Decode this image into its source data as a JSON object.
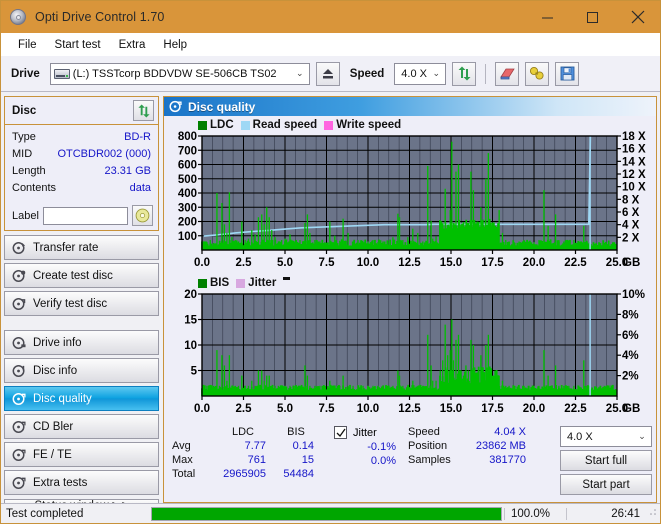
{
  "window": {
    "title": "Opti Drive Control 1.70",
    "title_icon": "disc-icon",
    "minimize": "–",
    "maximize": "□",
    "close": "✕",
    "accent_titlebar": "#d9953a"
  },
  "menubar": {
    "items": [
      {
        "label": "File"
      },
      {
        "label": "Start test"
      },
      {
        "label": "Extra"
      },
      {
        "label": "Help"
      }
    ]
  },
  "toolbar": {
    "drive_label": "Drive",
    "drive_value": "(L:)   TSSTcorp BDDVDW SE-506CB TS02",
    "eject_icon": "eject-icon",
    "speed_label": "Speed",
    "speed_value": "4.0 X",
    "refresh_icon": "refresh-icon",
    "erase_icon": "eraser-icon",
    "plug_icon": "plug-icon",
    "save_icon": "save-floppy-icon",
    "caret": "⌄"
  },
  "sidebar": {
    "disc_panel": {
      "title": "Disc",
      "refresh_icon": "refresh-icon",
      "rows": [
        {
          "key": "Type",
          "value": "BD-R"
        },
        {
          "key": "MID",
          "value": "OTCBDR002 (000)"
        },
        {
          "key": "Length",
          "value": "23.31 GB"
        },
        {
          "key": "Contents",
          "value": "data"
        }
      ],
      "label_key": "Label",
      "label_value": "",
      "label_placeholder": "",
      "label_button_icon": "disc-icon"
    },
    "items": [
      {
        "label": "Transfer rate",
        "icon": "disc-arrow-icon",
        "active": false
      },
      {
        "label": "Create test disc",
        "icon": "disc-write-icon",
        "active": false
      },
      {
        "label": "Verify test disc",
        "icon": "disc-check-icon",
        "active": false
      },
      {
        "label": "Drive info",
        "icon": "drive-info-icon",
        "active": false
      },
      {
        "label": "Disc info",
        "icon": "disc-info-icon",
        "active": false
      },
      {
        "label": "Disc quality",
        "icon": "disc-quality-icon",
        "active": true
      },
      {
        "label": "CD Bler",
        "icon": "disc-bler-icon",
        "active": false
      },
      {
        "label": "FE / TE",
        "icon": "disc-fete-icon",
        "active": false
      },
      {
        "label": "Extra tests",
        "icon": "disc-extra-icon",
        "active": false
      }
    ],
    "status_window_button": "Status window > >"
  },
  "main": {
    "header_title": "Disc quality",
    "header_icon": "disc-quality-icon"
  },
  "chart_data": [
    {
      "type": "line",
      "name": "ldc-chart",
      "title": "",
      "xlabel": "GB",
      "ylabel": "",
      "legend": [
        {
          "label": "LDC",
          "color": "#00a000"
        },
        {
          "label": "Read speed",
          "color": "#9fd8f5"
        },
        {
          "label": "Write speed",
          "color": "#ff66e0"
        }
      ],
      "legend_position": "top-left",
      "grid": true,
      "plot_bg": "#6b7489",
      "x": [
        0.0,
        2.5,
        5.0,
        7.5,
        10.0,
        12.5,
        15.0,
        17.5,
        20.0,
        22.5,
        25.0
      ],
      "xtick_labels": [
        "0.0",
        "2.5",
        "5.0",
        "7.5",
        "10.0",
        "12.5",
        "15.0",
        "17.5",
        "20.0",
        "22.5",
        "25.0"
      ],
      "xlim": [
        0.0,
        25.0
      ],
      "ylim": [
        0,
        800
      ],
      "ytick_labels": [
        "100",
        "200",
        "300",
        "400",
        "500",
        "600",
        "700",
        "800"
      ],
      "ytick_values": [
        100,
        200,
        300,
        400,
        500,
        600,
        700,
        800
      ],
      "y2lim": [
        0,
        18
      ],
      "y2tick_labels": [
        "2 X",
        "4 X",
        "6 X",
        "8 X",
        "10 X",
        "12 X",
        "14 X",
        "16 X",
        "18 X"
      ],
      "y2tick_values": [
        2,
        4,
        6,
        8,
        10,
        12,
        14,
        16,
        18
      ],
      "series": [
        {
          "name": "Read speed",
          "color": "#9fd8f5",
          "axis": "right",
          "x": [
            0.1,
            1.0,
            2.0,
            3.0,
            4.0,
            5.0,
            6.0,
            7.0,
            8.0,
            9.0,
            10.0,
            11.0,
            11.5,
            13.5,
            14.0,
            23.3,
            23.4
          ],
          "values": [
            2.2,
            2.4,
            2.7,
            2.9,
            3.1,
            3.3,
            3.5,
            3.6,
            3.7,
            3.8,
            3.9,
            4.0,
            4.0,
            4.0,
            4.05,
            4.05,
            18.0
          ]
        },
        {
          "name": "LDC",
          "color": "#00c000",
          "axis": "left",
          "note": "error spikes sampled across the disc",
          "x": [
            0.1,
            0.3,
            0.5,
            0.7,
            0.9,
            1.05,
            1.2,
            1.35,
            1.5,
            1.65,
            1.8,
            2.0,
            2.2,
            2.4,
            2.6,
            2.8,
            3.0,
            3.2,
            3.4,
            3.6,
            3.75,
            3.9,
            4.05,
            4.2,
            4.4,
            4.6,
            4.8,
            5.0,
            5.3,
            5.6,
            5.9,
            6.2,
            6.35,
            6.5,
            6.8,
            7.1,
            7.4,
            7.7,
            8.0,
            8.3,
            8.5,
            8.8,
            9.1,
            9.4,
            9.7,
            10.0,
            10.3,
            10.6,
            10.9,
            11.2,
            11.5,
            11.8,
            11.9,
            12.1,
            12.4,
            12.7,
            13.0,
            13.3,
            13.6,
            13.8,
            13.9,
            14.1,
            14.35,
            14.5,
            14.65,
            14.8,
            14.95,
            15.05,
            15.15,
            15.3,
            15.45,
            15.6,
            15.75,
            15.9,
            16.05,
            16.2,
            16.35,
            16.5,
            16.65,
            16.8,
            16.95,
            17.1,
            17.25,
            17.4,
            17.55,
            17.7,
            17.9,
            18.1,
            18.3,
            18.5,
            18.8,
            19.1,
            19.4,
            19.7,
            20.0,
            20.3,
            20.6,
            20.85,
            21.0,
            21.3,
            21.5,
            21.8,
            22.1,
            22.4,
            22.7,
            23.0,
            23.2,
            23.35
          ],
          "values": [
            60,
            55,
            70,
            50,
            400,
            65,
            330,
            180,
            120,
            405,
            90,
            70,
            60,
            200,
            70,
            80,
            140,
            110,
            230,
            250,
            180,
            300,
            230,
            140,
            90,
            60,
            70,
            80,
            110,
            60,
            70,
            190,
            250,
            120,
            70,
            60,
            55,
            200,
            100,
            65,
            220,
            120,
            60,
            70,
            55,
            60,
            70,
            55,
            60,
            65,
            90,
            255,
            230,
            70,
            90,
            150,
            120,
            60,
            590,
            205,
            80,
            95,
            140,
            175,
            430,
            175,
            280,
            760,
            185,
            550,
            600,
            180,
            175,
            175,
            190,
            550,
            420,
            180,
            175,
            300,
            175,
            500,
            680,
            190,
            175,
            60,
            280,
            120,
            70,
            60,
            55,
            60,
            70,
            60,
            55,
            70,
            420,
            170,
            60,
            250,
            70,
            60,
            55,
            70,
            60,
            170,
            60,
            55
          ]
        }
      ]
    },
    {
      "type": "line",
      "name": "bis-chart",
      "title": "",
      "xlabel": "GB",
      "ylabel": "",
      "legend": [
        {
          "label": "BIS",
          "color": "#00a000"
        },
        {
          "label": "Jitter",
          "color": "#d8a8e0"
        }
      ],
      "legend_position": "top-left",
      "grid": true,
      "plot_bg": "#6b7489",
      "xtick_labels": [
        "0.0",
        "2.5",
        "5.0",
        "7.5",
        "10.0",
        "12.5",
        "15.0",
        "17.5",
        "20.0",
        "22.5",
        "25.0"
      ],
      "xlim": [
        0.0,
        25.0
      ],
      "ylim": [
        0,
        20
      ],
      "ytick_labels": [
        "5",
        "10",
        "15",
        "20"
      ],
      "ytick_values": [
        5,
        10,
        15,
        20
      ],
      "y2lim": [
        0,
        10
      ],
      "y2tick_labels": [
        "2%",
        "4%",
        "6%",
        "8%",
        "10%"
      ],
      "y2tick_values": [
        2,
        4,
        6,
        8,
        10
      ],
      "series": [
        {
          "name": "BIS",
          "color": "#00c000",
          "axis": "left",
          "x": [
            0.1,
            0.3,
            0.5,
            0.7,
            0.9,
            1.05,
            1.2,
            1.35,
            1.5,
            1.65,
            1.8,
            2.0,
            2.2,
            2.4,
            2.6,
            2.8,
            3.0,
            3.2,
            3.4,
            3.6,
            3.75,
            3.9,
            4.05,
            4.2,
            4.4,
            4.6,
            4.8,
            5.0,
            5.3,
            5.6,
            5.9,
            6.2,
            6.35,
            6.5,
            6.8,
            7.1,
            7.4,
            7.7,
            8.0,
            8.3,
            8.5,
            8.8,
            9.1,
            9.4,
            9.7,
            10.0,
            10.3,
            10.6,
            10.9,
            11.2,
            11.5,
            11.8,
            11.9,
            12.1,
            12.4,
            12.7,
            13.0,
            13.3,
            13.6,
            13.8,
            13.9,
            14.1,
            14.35,
            14.5,
            14.65,
            14.8,
            14.95,
            15.05,
            15.15,
            15.3,
            15.45,
            15.6,
            15.75,
            15.9,
            16.05,
            16.2,
            16.35,
            16.5,
            16.65,
            16.8,
            16.95,
            17.1,
            17.25,
            17.4,
            17.55,
            17.7,
            17.9,
            18.1,
            18.3,
            18.5,
            18.8,
            19.1,
            19.4,
            19.7,
            20.0,
            20.3,
            20.6,
            20.85,
            21.0,
            21.3,
            21.5,
            21.8,
            22.1,
            22.4,
            22.7,
            23.0,
            23.2,
            23.35
          ],
          "values": [
            2,
            2,
            2,
            2,
            9,
            2,
            8,
            6,
            3,
            8,
            2,
            2,
            2,
            4,
            2,
            2,
            3,
            2,
            5,
            5,
            3,
            4,
            4,
            2,
            2,
            2,
            2,
            2,
            2,
            2,
            2,
            6,
            4,
            2,
            2,
            2,
            2,
            3,
            2,
            2,
            4,
            2,
            2,
            2,
            2,
            2,
            2,
            2,
            2,
            2,
            2,
            5,
            4,
            2,
            2,
            3,
            2,
            2,
            12,
            6,
            3,
            3,
            5,
            7,
            14,
            8,
            9,
            15,
            7,
            11,
            12,
            5,
            4,
            6,
            5,
            11,
            10,
            4,
            5,
            8,
            4,
            10,
            12,
            5,
            4,
            2,
            4,
            3,
            2,
            2,
            2,
            2,
            2,
            2,
            2,
            2,
            9,
            4,
            2,
            6,
            2,
            2,
            2,
            2,
            2,
            7,
            2,
            2
          ]
        },
        {
          "name": "Jitter",
          "color": "#d8a8e0",
          "axis": "right",
          "x": [],
          "values": []
        }
      ]
    }
  ],
  "stats": {
    "col_headers": [
      "LDC",
      "BIS"
    ],
    "rows": [
      {
        "label": "Avg",
        "ldc": "7.77",
        "bis": "0.14",
        "jitter": "-0.1%"
      },
      {
        "label": "Max",
        "ldc": "761",
        "bis": "15",
        "jitter": "0.0%"
      },
      {
        "label": "Total",
        "ldc": "2965905",
        "bis": "54484",
        "jitter": ""
      }
    ],
    "jitter_label": "Jitter",
    "jitter_checked": true,
    "jitter_check_glyph": "✓",
    "speed_label": "Speed",
    "speed_value": "4.04 X",
    "position_label": "Position",
    "position_value": "23862 MB",
    "samples_label": "Samples",
    "samples_value": "381770",
    "speed_select": "4.0 X",
    "speed_caret": "⌄",
    "start_full_button": "Start full",
    "start_part_button": "Start part"
  },
  "statusbar": {
    "text": "Test completed",
    "progress_percent": "100.0%",
    "progress_value": 100,
    "elapsed": "26:41",
    "progress_color": "#00a600"
  }
}
